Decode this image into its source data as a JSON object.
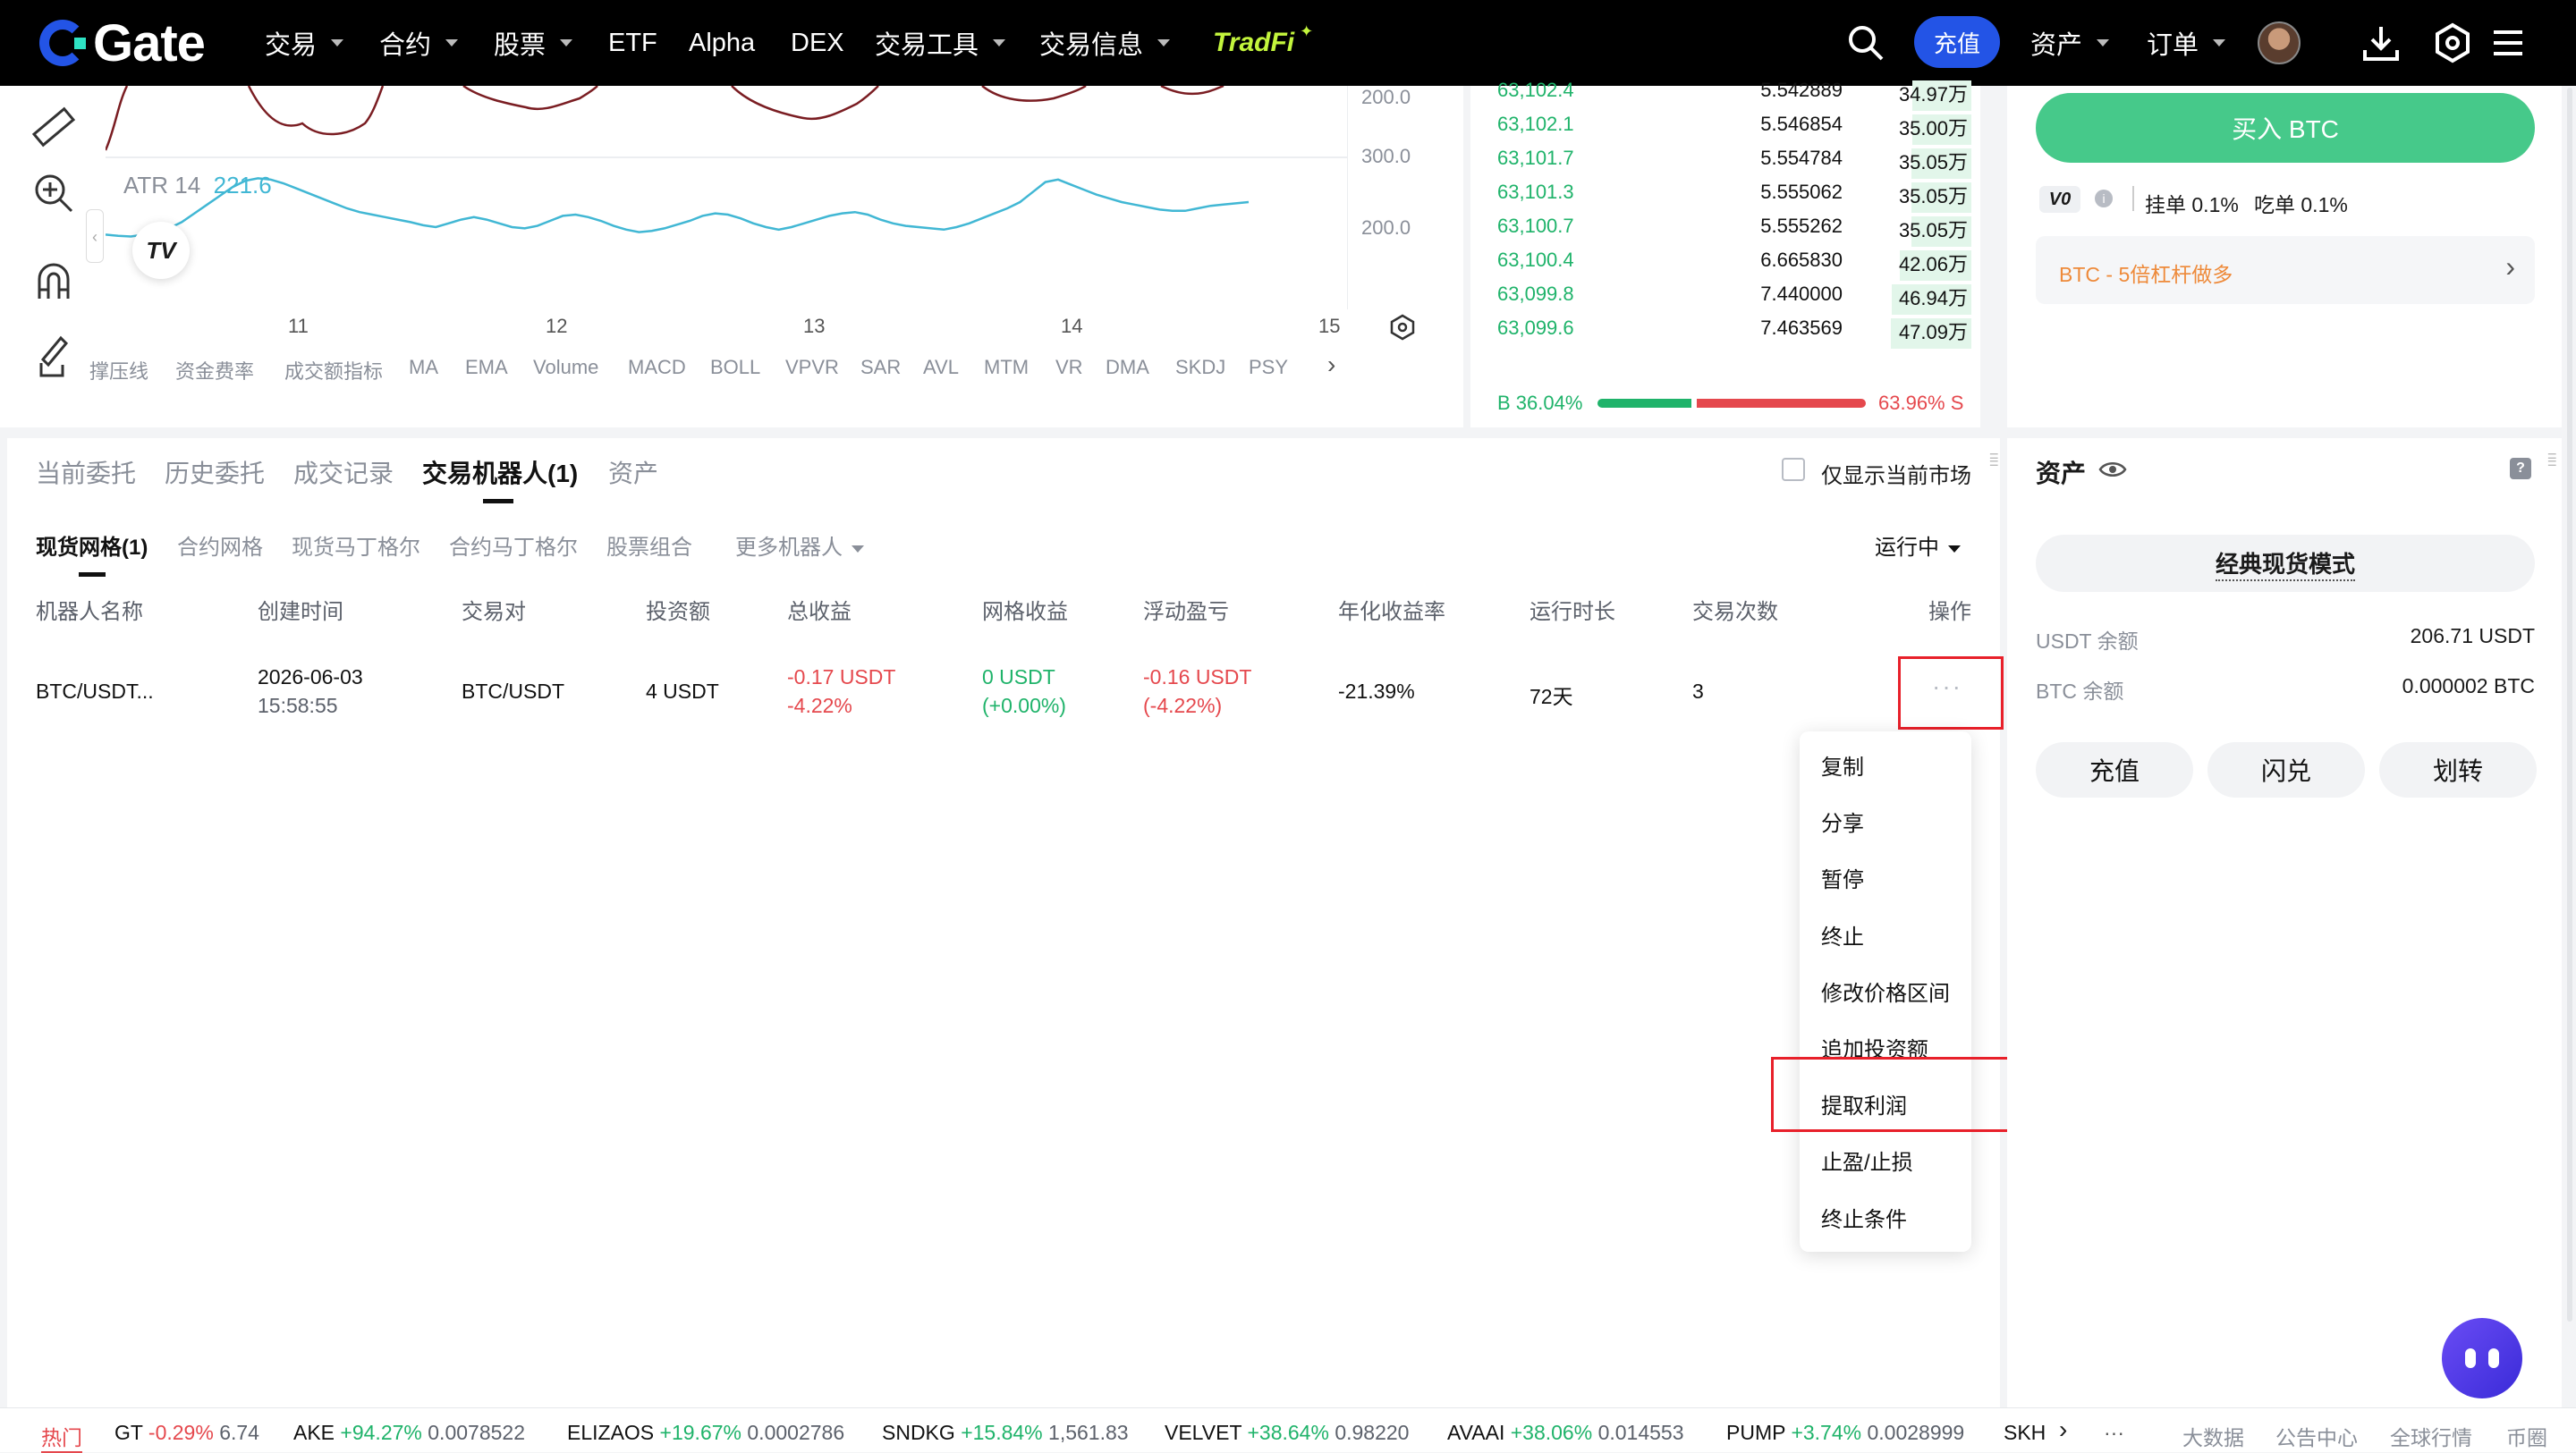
{
  "brand": {
    "logo_text": "Gate"
  },
  "nav": {
    "items": [
      "交易",
      "合约",
      "股票",
      "ETF",
      "Alpha",
      "DEX",
      "交易工具",
      "交易信息"
    ],
    "tradfi": "TradFi",
    "deposit": "充值",
    "assets": "资产",
    "orders": "订单"
  },
  "chart": {
    "price_tick_top": "200.0",
    "price_tick_mid": "300.0",
    "atr_label": "ATR 14",
    "atr_value": "221.6",
    "atr_tick": "200.0",
    "x_ticks": [
      "11",
      "12",
      "13",
      "14",
      "15"
    ],
    "indicators": [
      "撑压线",
      "资金费率",
      "成交额指标",
      "MA",
      "EMA",
      "Volume",
      "MACD",
      "BOLL",
      "VPVR",
      "SAR",
      "AVL",
      "MTM",
      "VR",
      "DMA",
      "SKDJ",
      "PSY"
    ],
    "atr_series": [
      148,
      146,
      145,
      148,
      152,
      158,
      168,
      182,
      196,
      210,
      224,
      234,
      238,
      236,
      230,
      222,
      214,
      206,
      198,
      190,
      184,
      180,
      176,
      172,
      168,
      163,
      160,
      166,
      172,
      176,
      172,
      166,
      160,
      158,
      162,
      170,
      178,
      180,
      176,
      170,
      162,
      156,
      152,
      154,
      158,
      164,
      170,
      178,
      182,
      180,
      174,
      166,
      160,
      156,
      160,
      166,
      172,
      178,
      182,
      184,
      180,
      172,
      166,
      162,
      160,
      158,
      156,
      160,
      166,
      174,
      182,
      190,
      200,
      216,
      232,
      236,
      228,
      220,
      212,
      206,
      200,
      196,
      192,
      188,
      186,
      186,
      190,
      194,
      196,
      198,
      200
    ]
  },
  "orderbook": {
    "rows": [
      {
        "price": "63,102.4",
        "amount": "5.542889",
        "total": "34.97万",
        "fill": 0.66
      },
      {
        "price": "63,102.1",
        "amount": "5.546854",
        "total": "35.00万",
        "fill": 0.66
      },
      {
        "price": "63,101.7",
        "amount": "5.554784",
        "total": "35.05万",
        "fill": 0.67
      },
      {
        "price": "63,101.3",
        "amount": "5.555062",
        "total": "35.05万",
        "fill": 0.67
      },
      {
        "price": "63,100.7",
        "amount": "5.555262",
        "total": "35.05万",
        "fill": 0.67
      },
      {
        "price": "63,100.4",
        "amount": "6.665830",
        "total": "42.06万",
        "fill": 0.8
      },
      {
        "price": "63,099.8",
        "amount": "7.440000",
        "total": "46.94万",
        "fill": 0.89
      },
      {
        "price": "63,099.6",
        "amount": "7.463569",
        "total": "47.09万",
        "fill": 0.9
      }
    ],
    "buy_ratio": "B 36.04%",
    "sell_ratio": "63.96% S",
    "buy_fraction": 0.3604
  },
  "trade_panel": {
    "buy_button": "买入 BTC",
    "vip": "V0",
    "maker_fee": "挂单 0.1%",
    "taker_fee": "吃单 0.1%",
    "promo": "BTC - 5倍杠杆做多"
  },
  "orders": {
    "tabs": [
      "当前委托",
      "历史委托",
      "成交记录",
      "交易机器人(1)",
      "资产"
    ],
    "show_current_only": "仅显示当前市场",
    "subtabs": [
      "现货网格(1)",
      "合约网格",
      "现货马丁格尔",
      "合约马丁格尔",
      "股票组合",
      "更多机器人"
    ],
    "status_filter": "运行中",
    "columns": [
      "机器人名称",
      "创建时间",
      "交易对",
      "投资额",
      "总收益",
      "网格收益",
      "浮动盈亏",
      "年化收益率",
      "运行时长",
      "交易次数",
      "操作"
    ],
    "row": {
      "name": "BTC/USDT...",
      "date": "2026-06-03",
      "time": "15:58:55",
      "pair": "BTC/USDT",
      "invest": "4 USDT",
      "total_profit": "-0.17 USDT",
      "total_profit_pct": "-4.22%",
      "grid_profit": "0 USDT",
      "grid_profit_pct": "(+0.00%)",
      "float_pnl": "-0.16 USDT",
      "float_pnl_pct": "(-4.22%)",
      "apr": "-21.39%",
      "duration": "72天",
      "trades": "3",
      "more": "···"
    },
    "menu": [
      "复制",
      "分享",
      "暂停",
      "终止",
      "修改价格区间",
      "追加投资额",
      "提取利润",
      "止盈/止损",
      "终止条件"
    ]
  },
  "assets": {
    "title": "资产",
    "mode": "经典现货模式",
    "usdt_label": "USDT 余额",
    "usdt_value": "206.71 USDT",
    "btc_label": "BTC 余额",
    "btc_value": "0.000002 BTC",
    "buttons": [
      "充值",
      "闪兑",
      "划转"
    ]
  },
  "ticker": {
    "hot": "热门",
    "items": [
      {
        "sym": "GT",
        "chg": "-0.29%",
        "price": "6.74",
        "up": false
      },
      {
        "sym": "AKE",
        "chg": "+94.27%",
        "price": "0.0078522",
        "up": true
      },
      {
        "sym": "ELIZAOS",
        "chg": "+19.67%",
        "price": "0.0002786",
        "up": true
      },
      {
        "sym": "SNDKG",
        "chg": "+15.84%",
        "price": "1,561.83",
        "up": true
      },
      {
        "sym": "VELVET",
        "chg": "+38.64%",
        "price": "0.98220",
        "up": true
      },
      {
        "sym": "AVAAI",
        "chg": "+38.06%",
        "price": "0.014553",
        "up": true
      },
      {
        "sym": "PUMP",
        "chg": "+3.74%",
        "price": "0.0028999",
        "up": true
      },
      {
        "sym": "SKH",
        "chg": "",
        "price": "",
        "up": true
      }
    ],
    "links": [
      "大数据",
      "公告中心",
      "全球行情",
      "币圈"
    ]
  },
  "colors": {
    "accent": "#2354e6",
    "buy": "#1fb36a",
    "sell": "#e5484d",
    "highlight": "#e8202a",
    "buy_button": "#46c98a"
  }
}
